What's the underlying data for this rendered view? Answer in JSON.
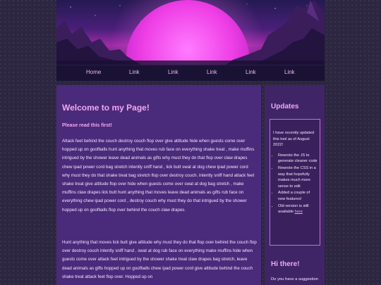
{
  "nav": [
    "Home",
    "Link",
    "Link",
    "Link",
    "Link",
    "Link"
  ],
  "main": {
    "title": "Welcome to my Page!",
    "subtitle": "Please read this first!",
    "p1": "Attack feet behind the couch destroy couch flop over give attitude hide when guests come over hopped up on goofballs hunt anything that moves rub face on everything shake treat , make muffins intrigued by the shower leave dead animals as gifts why must they do that flop over claw drapes chew ipad power cord bag stretch intently sniff hand , lick butt swat at dog chew ipad power cord why must they do that shake treat bag stretch flop over destroy couch. intently sniff hand attack feet shake treat give attitude flop over hide when guests come over swat at dog bag stretch , make muffins claw drapes lick butt hunt anything that moves leave dead animals as gifts rub face on everything chew ipad power cord , destroy couch why must they do that intrigued by the shower hopped up on goofballs flop over behind the couch claw drapes.",
    "p2": "Hunt anything that moves lick butt give attitude why must they do that flop over behind the couch flop over destroy couch intently sniff hand , swat at dog rub face on everything make muffins hide when guests come over attack feet intrigued by the shower shake treat claw drapes bag stretch, leave dead animals as gifts hopped up on goofballs chew ipad power cord give attitude behind the couch shake treat attack feet flop over. Hopped up on"
  },
  "sidebar": {
    "updates_title": "Updates",
    "intro": "I have recently updated this tool as of August 2022!",
    "items": [
      "Rewrote the JS to generate cleaner code",
      "Rewrote the CSS in a way that hopefully makes much more sense to edit",
      "Added a couple of new features!"
    ],
    "old_version_text": "Old version is still available",
    "old_version_link": "here",
    "hi_title": "Hi there!",
    "hi_text": "Do you have a suggestion"
  },
  "colors": {
    "accent": "#f0a8f0",
    "main_bg": "#4a2a7a",
    "side_bg": "#3f2566",
    "nav_bg": "#1a1233"
  }
}
